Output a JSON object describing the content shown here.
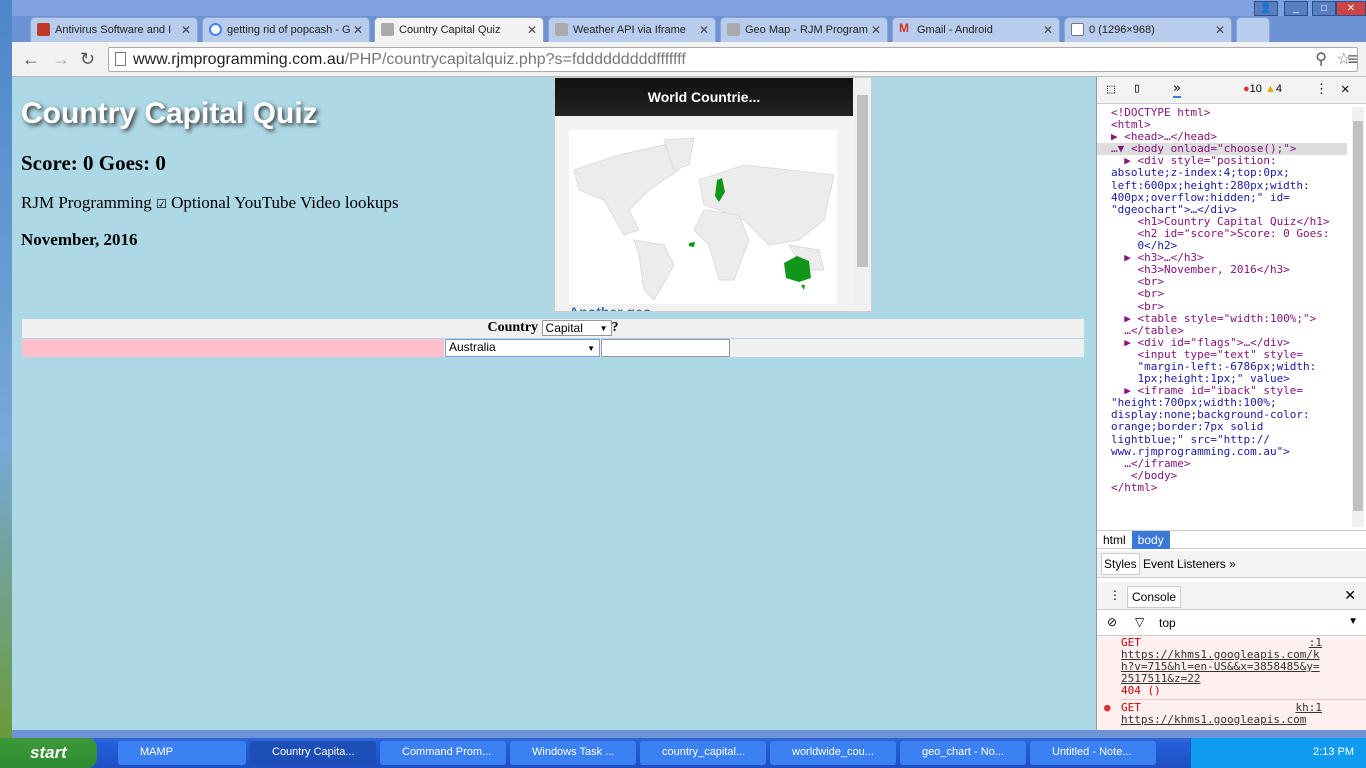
{
  "browser": {
    "tabs": [
      {
        "label": "Antivirus Software and I",
        "icon": "mcafee-shield-icon",
        "color": "#c0392b"
      },
      {
        "label": "getting rid of popcash - G",
        "icon": "google-icon",
        "color": "#4285f4"
      },
      {
        "label": "Country Capital Quiz",
        "icon": "page-icon",
        "color": "#999999",
        "active": true
      },
      {
        "label": "Weather API via Iframe",
        "icon": "page-icon",
        "color": "#999999"
      },
      {
        "label": "Geo Map - RJM Program",
        "icon": "page-icon",
        "color": "#999999"
      },
      {
        "label": "Gmail - Android",
        "icon": "gmail-icon",
        "color": "#d93025"
      },
      {
        "label": "0 (1296×968)",
        "icon": "document-icon",
        "color": "#ffffff"
      }
    ],
    "url_host": "www.rjmprogramming.com.au",
    "url_path": "/PHP/countrycapitalquiz.php?s=fdddddddddfffffff"
  },
  "page": {
    "title": "Country Capital Quiz",
    "score": "Score: 0 Goes: 0",
    "site": "RJM Programming",
    "youtube_label": "Optional YouTube Video lookups",
    "youtube_checked": true,
    "date": "November, 2016",
    "geochart": {
      "title": "World Countrie...",
      "link": "Another geo",
      "highlighted": [
        "Finland",
        "Australia",
        "Sierra Leone"
      ],
      "highlight_color": "#109618"
    },
    "quiz": {
      "country_label": "Country",
      "mode_select": "Capital",
      "question_mark": "?",
      "country_select": "Australia",
      "answer": ""
    },
    "background": "#add8e6"
  },
  "devtools": {
    "errors": "10",
    "warnings": "4",
    "code": [
      "<!DOCTYPE html>",
      "<html>",
      "▶ <head>…</head>",
      "…▼ <body onload=\"choose();\">",
      "  ▶ <div style=\"position:",
      "absolute;z-index:4;top:0px;",
      "left:600px;height:280px;width:",
      "400px;overflow:hidden;\" id=",
      "\"dgeochart\">…</div>",
      "    <h1>Country Capital Quiz</h1>",
      "    <h2 id=\"score\">Score: 0 Goes:",
      "    0</h2>",
      "  ▶ <h3>…</h3>",
      "    <h3>November, 2016</h3>",
      "    <br>",
      "    <br>",
      "    <br>",
      "  ▶ <table style=\"width:100%;\">",
      "  …</table>",
      "  ▶ <div id=\"flags\">…</div>",
      "    <input type=\"text\" style=",
      "    \"margin-left:-6786px;width:",
      "    1px;height:1px;\" value>",
      "  ▶ <iframe id=\"iback\" style=",
      "\"height:700px;width:100%;",
      "display:none;background-color:",
      "orange;border:7px solid",
      "lightblue;\" src=\"http://",
      "www.rjmprogramming.com.au\">",
      "  …</iframe>",
      "   </body>",
      "</html>"
    ],
    "crumbs": [
      "html",
      "body"
    ],
    "panels": [
      "Styles",
      "Event Listeners"
    ],
    "console_tab": "Console",
    "context": "top",
    "log": [
      {
        "src": ":1",
        "method": "GET",
        "url": "https://khms1.googleapis.com/kh?v=715&hl=en-US&&x=3858485&y=2517511&z=22",
        "status": "404 ()"
      },
      {
        "src": "kh:1",
        "method": "GET",
        "url": "https://khms1.googleapis.com"
      }
    ]
  },
  "taskbar": {
    "start": "start",
    "items": [
      "MAMP",
      "Country Capita...",
      "Command Prom...",
      "Windows Task ...",
      "country_capital...",
      "worldwide_cou...",
      "geo_chart - No...",
      "Untitled - Note..."
    ],
    "clock": "2:13 PM"
  }
}
